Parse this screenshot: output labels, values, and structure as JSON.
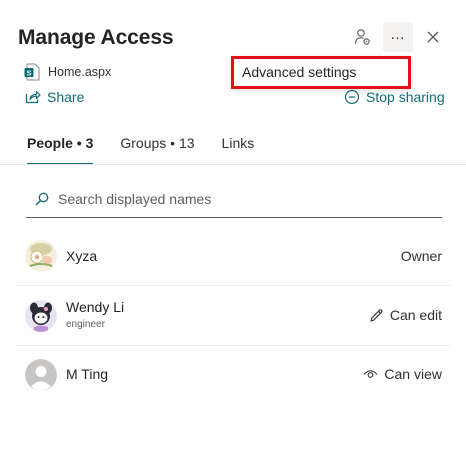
{
  "panel": {
    "title": "Manage Access"
  },
  "menu": {
    "items": [
      {
        "label": "Advanced settings"
      }
    ]
  },
  "file": {
    "name": "Home.aspx",
    "icon": "sharepoint-page-icon"
  },
  "actions": {
    "share_label": "Share",
    "stop_sharing_label": "Stop sharing"
  },
  "tabs": [
    {
      "label": "People • 3",
      "active": true
    },
    {
      "label": "Groups • 13",
      "active": false
    },
    {
      "label": "Links",
      "active": false
    }
  ],
  "search": {
    "placeholder": "Search displayed names",
    "value": ""
  },
  "people": [
    {
      "name": "Xyza",
      "role": "",
      "permission": "Owner",
      "permission_icon": ""
    },
    {
      "name": "Wendy Li",
      "role": "engineer",
      "permission": "Can edit",
      "permission_icon": "pencil-icon"
    },
    {
      "name": "M Ting",
      "role": "",
      "permission": "Can view",
      "permission_icon": "eye-icon"
    }
  ],
  "colors": {
    "accent": "#0f6b76",
    "highlight_border": "#e3101a"
  }
}
